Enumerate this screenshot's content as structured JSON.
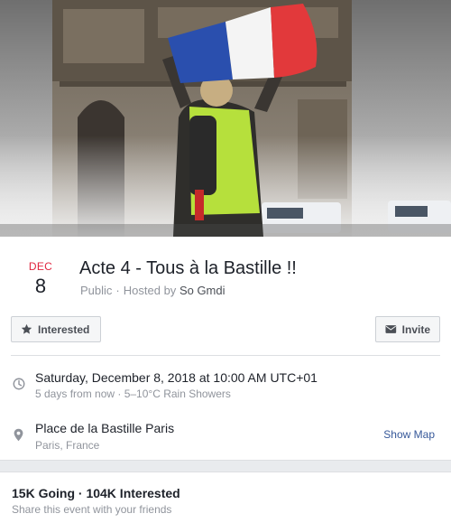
{
  "event": {
    "month": "DEC",
    "day": "8",
    "title": "Acte 4 - Tous à la Bastille !!",
    "privacy": "Public",
    "separator": "·",
    "hosted_by_label": "Hosted by",
    "host": "So Gmdi"
  },
  "actions": {
    "interested_label": "Interested",
    "invite_label": "Invite"
  },
  "details": {
    "datetime": "Saturday, December 8, 2018 at 10:00 AM UTC+01",
    "datetime_sub": "5 days from now · 5–10°C Rain Showers",
    "place": "Place de la Bastille Paris",
    "place_sub": "Paris, France",
    "show_map_label": "Show Map"
  },
  "stats": {
    "summary": "15K Going · 104K Interested",
    "share_prompt": "Share this event with your friends"
  },
  "colors": {
    "month_red": "#e0263f",
    "link_blue": "#365899",
    "muted_text": "#90949c"
  },
  "icons": {
    "interested": "star-icon",
    "invite": "envelope-icon",
    "time": "clock-icon",
    "place": "map-pin-icon"
  }
}
